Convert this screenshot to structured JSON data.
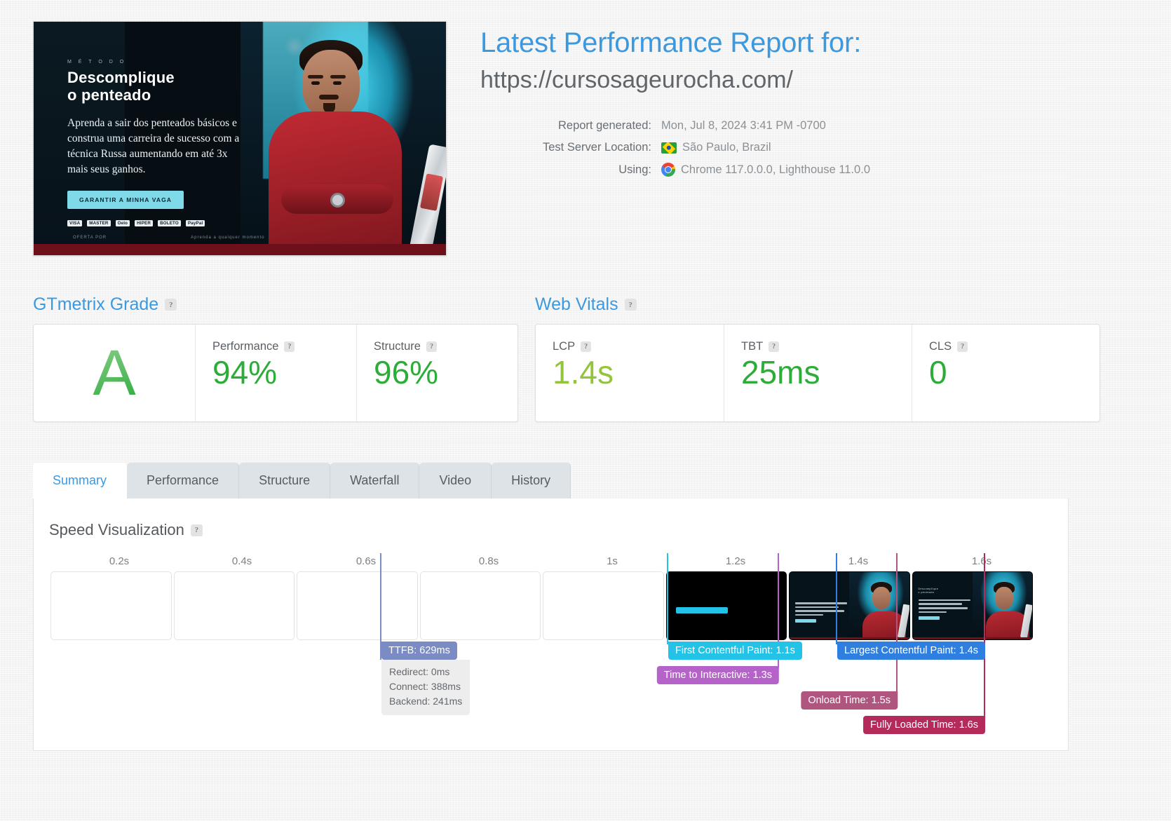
{
  "hero": {
    "kicker": "M É T O D O",
    "headline_line1": "Descomplique",
    "headline_line2": "o penteado",
    "paragraph": "Aprenda a sair dos penteados básicos e construa uma carreira de sucesso com a técnica Russa aumentando em até 3x mais seus ganhos.",
    "cta_label": "GARANTIR A MINHA VAGA",
    "payment_methods": [
      "VISA",
      "MASTER",
      "Oelo",
      "HIPER",
      "BOLETO",
      "PayPal"
    ],
    "footer_left": "OFERTA POR",
    "footer_right": "Aprenda a qualquer momento"
  },
  "report": {
    "title": "Latest Performance Report for:",
    "url": "https://cursosageurocha.com/",
    "meta": [
      {
        "label": "Report generated:",
        "value": "Mon, Jul 8, 2024 3:41 PM -0700",
        "icon": ""
      },
      {
        "label": "Test Server Location:",
        "value": "São Paulo, Brazil",
        "icon": "brazil-flag-icon"
      },
      {
        "label": "Using:",
        "value": "Chrome 117.0.0.0, Lighthouse 11.0.0",
        "icon": "chrome-icon"
      }
    ]
  },
  "gtmetrix_grade": {
    "title": "GTmetrix Grade",
    "help": "?",
    "grade": "A",
    "metrics": [
      {
        "label": "Performance",
        "value": "94%",
        "color": "#2cad38"
      },
      {
        "label": "Structure",
        "value": "96%",
        "color": "#2cad38"
      }
    ]
  },
  "web_vitals": {
    "title": "Web Vitals",
    "help": "?",
    "metrics": [
      {
        "label": "LCP",
        "value": "1.4s",
        "color": "#94c33d"
      },
      {
        "label": "TBT",
        "value": "25ms",
        "color": "#2cad38"
      },
      {
        "label": "CLS",
        "value": "0",
        "color": "#2cad38"
      }
    ]
  },
  "tabs": [
    {
      "label": "Summary",
      "active": true
    },
    {
      "label": "Performance",
      "active": false
    },
    {
      "label": "Structure",
      "active": false
    },
    {
      "label": "Waterfall",
      "active": false
    },
    {
      "label": "Video",
      "active": false
    },
    {
      "label": "History",
      "active": false
    }
  ],
  "speed_visualization": {
    "title": "Speed Visualization",
    "help": "?",
    "axis_ticks": [
      "0.2s",
      "0.4s",
      "0.6s",
      "0.8s",
      "1s",
      "1.2s",
      "1.4s",
      "1.6s"
    ],
    "frames": [
      {
        "state": "blank"
      },
      {
        "state": "blank"
      },
      {
        "state": "blank"
      },
      {
        "state": "blank"
      },
      {
        "state": "blank"
      },
      {
        "state": "loading"
      },
      {
        "state": "partial"
      },
      {
        "state": "rendered"
      }
    ],
    "markers": [
      {
        "name": "ttfb",
        "label": "TTFB: 629ms",
        "time": "629ms",
        "color": "#7b8cc4"
      },
      {
        "name": "first-contentful-paint",
        "label": "First Contentful Paint: 1.1s",
        "time": "1.1s",
        "color": "#22c3e6"
      },
      {
        "name": "time-to-interactive",
        "label": "Time to Interactive: 1.3s",
        "time": "1.3s",
        "color": "#b563c9"
      },
      {
        "name": "largest-contentful-paint",
        "label": "Largest Contentful Paint: 1.4s",
        "time": "1.4s",
        "color": "#2f7fe0"
      },
      {
        "name": "onload-time",
        "label": "Onload Time: 1.5s",
        "time": "1.5s",
        "color": "#b0567e"
      },
      {
        "name": "fully-loaded-time",
        "label": "Fully Loaded Time: 1.6s",
        "time": "1.6s",
        "color": "#b32a5b"
      }
    ],
    "ttfb_detail": [
      "Redirect: 0ms",
      "Connect: 388ms",
      "Backend: 241ms"
    ]
  }
}
